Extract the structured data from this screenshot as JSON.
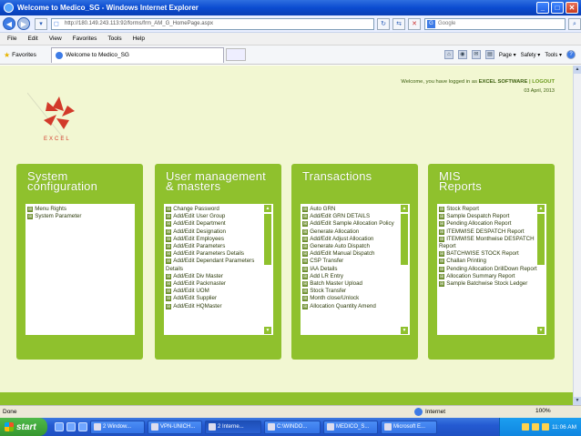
{
  "window": {
    "title": "Welcome to Medico_SG - Windows Internet Explorer",
    "buttons": {
      "minimize": "_",
      "maximize": "□",
      "close": "✕"
    }
  },
  "addressbar": {
    "url": "http://180.149.243.113:92/forms/frm_AM_G_HomePage.aspx",
    "search_placeholder": "Google"
  },
  "menu": [
    "File",
    "Edit",
    "View",
    "Favorites",
    "Tools",
    "Help"
  ],
  "favorites": {
    "label": "Favorites",
    "tab_label": "Welcome to Medico_SG",
    "commands": [
      "Page ▾",
      "Safety ▾",
      "Tools ▾"
    ]
  },
  "header": {
    "welcome_prefix": "Welcome, you have logged in as",
    "user": "EXCEL SOFTWARE",
    "separator": "|",
    "logout": "LOGOUT",
    "date": "03 April, 2013",
    "logo_text": "EXCEL"
  },
  "panels": [
    {
      "title_line1": "System",
      "title_line2": "configuration",
      "items": [
        "Menu Rights",
        "System Parameter"
      ],
      "scroll": false
    },
    {
      "title_line1": "User management",
      "title_line2": "& masters",
      "items": [
        "Change Password",
        "Add/Edit User Group",
        "Add/Edit Department",
        "Add/Edit Designation",
        "Add/Edit Employees",
        "Add/Edit Parameters",
        "Add/Edit Parameters Details",
        "Add/Edit Dependant Parameters Details",
        "Add/Edit Div Master",
        "Add/Edit Packmaster",
        "Add/Edit UOM",
        "Add/Edit Supplier",
        "Add/Edit HQMaster"
      ],
      "scroll": true
    },
    {
      "title_line1": "Transactions",
      "title_line2": "",
      "items": [
        "Auto GRN",
        "Add/Edit GRN DETAILS",
        "Add/Edit Sample Allocation Policy",
        "Generate Allocation",
        "Add/Edit Adjust Allocation",
        "Generate Auto Dispatch",
        "Add/Edit Manual Dispatch",
        "CSP Transfer",
        "IAA Details",
        "Add LR Entry",
        "Batch Master Upload",
        "Stock Transfer",
        "Month close/Unlock",
        "Allocation Quantity Amend"
      ],
      "scroll": true
    },
    {
      "title_line1": "MIS",
      "title_line2": "Reports",
      "items": [
        "Stock Report",
        "Sample Despatch Report",
        "Pending Allocation Report",
        "ITEMWISE DESPATCH Report",
        "ITEMWISE Monthwise DESPATCH Report",
        "BATCHWISE STOCK Report",
        "Challan Printing",
        "Pending Allocation DrillDown Report",
        "Allocation Summary Report",
        "Sample Batchwise Stock Ledger"
      ],
      "scroll": true
    }
  ],
  "statusbar": {
    "left": "Done",
    "zone": "Internet",
    "zoom": "100%"
  },
  "taskbar": {
    "start": "start",
    "buttons": [
      "2 Window...",
      "VPN-UNICH...",
      "2 Interne...",
      "C:\\WINDO...",
      "MEDICO_S...",
      "Microsoft E..."
    ],
    "clock": "11:06 AM"
  }
}
